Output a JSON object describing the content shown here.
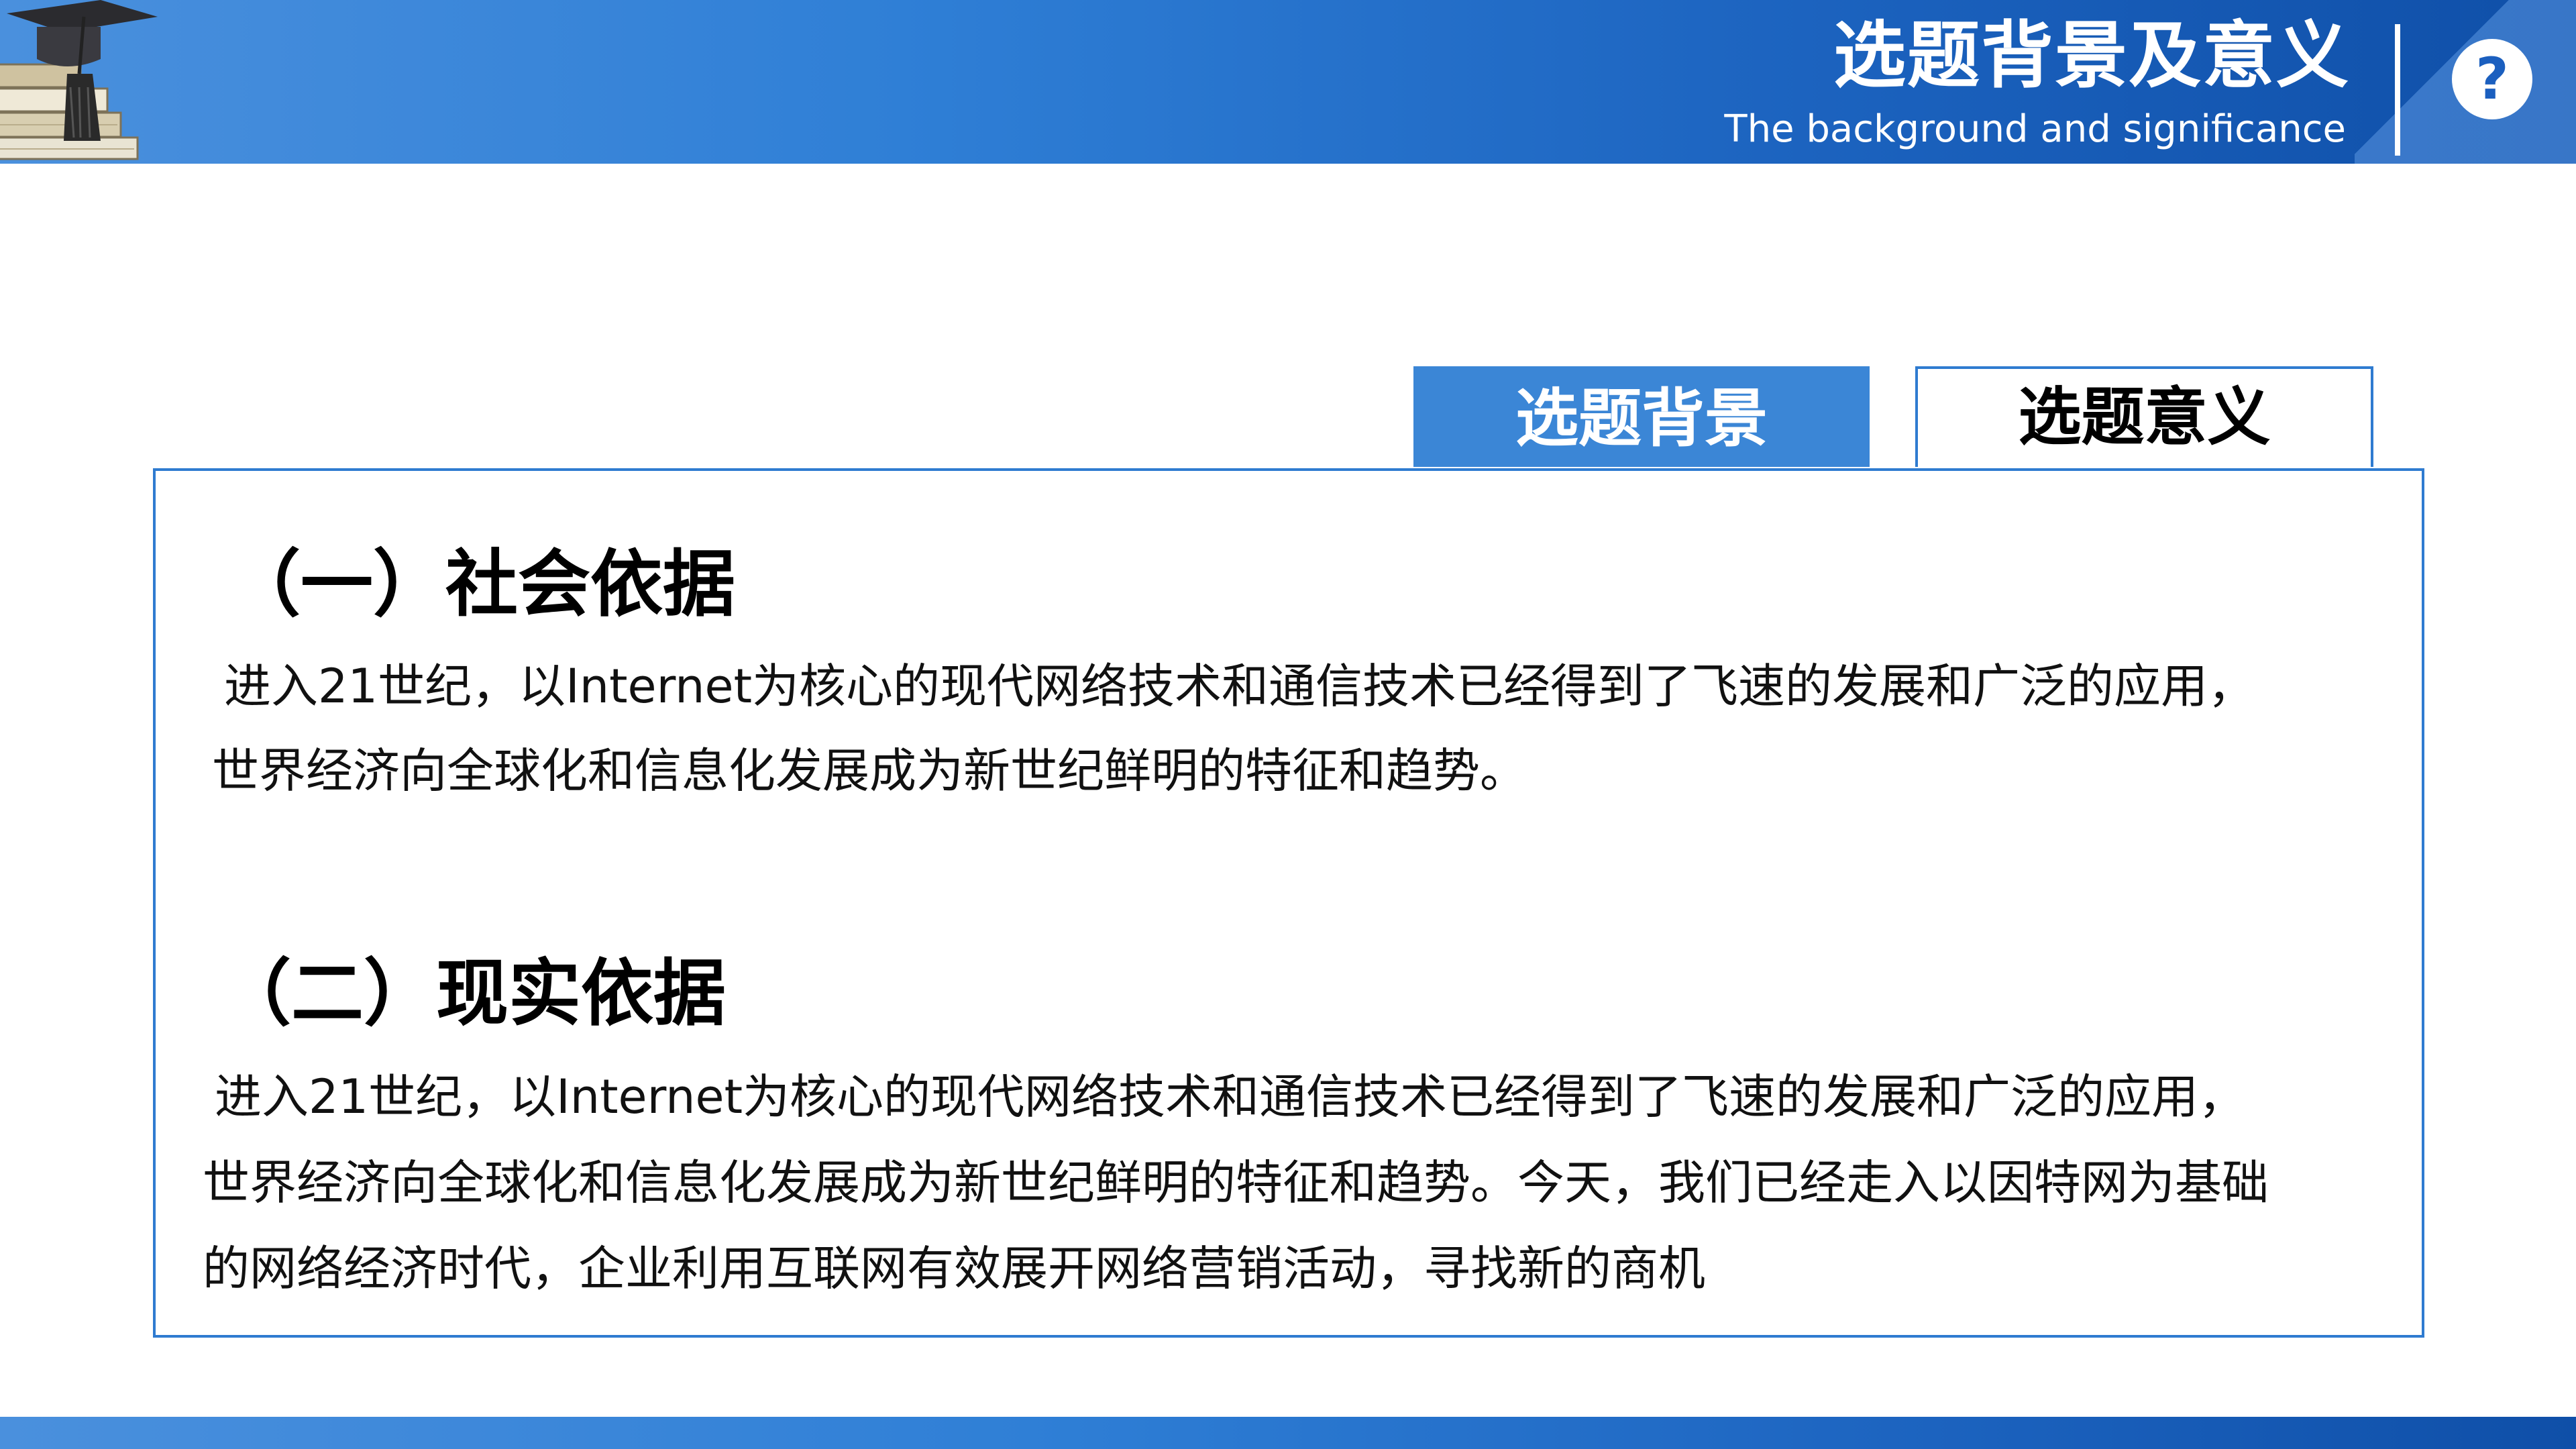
{
  "header": {
    "title": "选题背景及意义",
    "subtitle": "The background and significance",
    "help_icon_glyph": "?"
  },
  "tabs": [
    {
      "label": "选题背景",
      "active": true
    },
    {
      "label": "选题意义",
      "active": false
    }
  ],
  "sections": [
    {
      "heading": "（一）社会依据",
      "lines": [
        "进入21世纪，以Internet为核心的现代网络技术和通信技术已经得到了飞速的发展和广泛的应用，",
        "世界经济向全球化和信息化发展成为新世纪鲜明的特征和趋势。"
      ]
    },
    {
      "heading": "（二）现实依据",
      "lines": [
        "进入21世纪，以Internet为核心的现代网络技术和通信技术已经得到了飞速的发展和广泛的应用，",
        "世界经济向全球化和信息化发展成为新世纪鲜明的特征和趋势。今天，我们已经走入以因特网为基础",
        "的网络经济时代，企业利用互联网有效展开网络营销活动，寻找新的商机"
      ]
    }
  ],
  "colors": {
    "primary_blue": "#2f7bd0",
    "active_tab_blue": "#3b86d6",
    "header_dark_blue": "#0f4fa8"
  },
  "icons": {
    "logo": "graduation-cap-books-icon",
    "help": "question-circle-icon"
  }
}
